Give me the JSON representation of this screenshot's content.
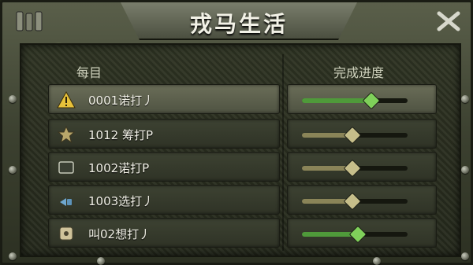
{
  "title": "戎马生活",
  "header": {
    "col_left": "每目",
    "col_right": "完成进度"
  },
  "colors": {
    "green_fill": "#4f9a3a",
    "green_knob": "#7fd05a",
    "tan_fill": "#8a8458",
    "tan_knob": "#c6be8a"
  },
  "rows": [
    {
      "icon": "warning-icon",
      "label": "0001诺打丿",
      "progress": 0.65,
      "style": "green",
      "selected": true
    },
    {
      "icon": "star-icon",
      "label": "1012 筹打P",
      "progress": 0.47,
      "style": "tan",
      "selected": false
    },
    {
      "icon": "screen-icon",
      "label": "1002诺打P",
      "progress": 0.47,
      "style": "tan",
      "selected": false
    },
    {
      "icon": "signal-icon",
      "label": "1003选打丿",
      "progress": 0.47,
      "style": "tan",
      "selected": false
    },
    {
      "icon": "box-icon",
      "label": "叫02想打丿",
      "progress": 0.52,
      "style": "green",
      "selected": false
    }
  ]
}
